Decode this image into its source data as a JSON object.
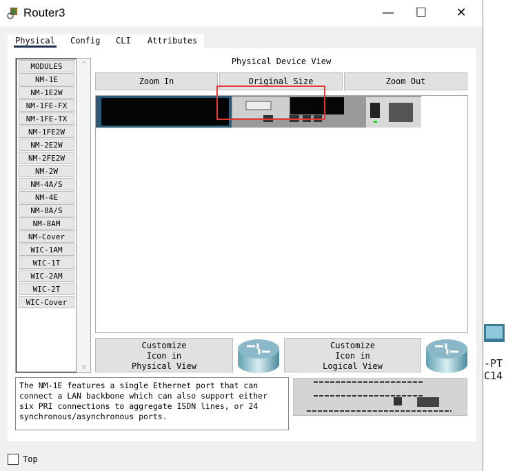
{
  "window": {
    "title": "Router3",
    "minimize": "—",
    "maximize": "☐",
    "close": "✕"
  },
  "tabs": [
    {
      "label": "Physical",
      "active": true
    },
    {
      "label": "Config"
    },
    {
      "label": "CLI"
    },
    {
      "label": "Attributes"
    }
  ],
  "modules": [
    "MODULES",
    "NM-1E",
    "NM-1E2W",
    "NM-1FE-FX",
    "NM-1FE-TX",
    "NM-1FE2W",
    "NM-2E2W",
    "NM-2FE2W",
    "NM-2W",
    "NM-4A/S",
    "NM-4E",
    "NM-8A/S",
    "NM-8AM",
    "NM-Cover",
    "WIC-1AM",
    "WIC-1T",
    "WIC-2AM",
    "WIC-2T",
    "WIC-Cover"
  ],
  "scroll": {
    "up": "^",
    "down": "v"
  },
  "physical_view": {
    "title": "Physical Device View",
    "zoom_in": "Zoom In",
    "original_size": "Original Size",
    "zoom_out": "Zoom Out",
    "highlight_color": "#e53935"
  },
  "customize": {
    "physical": [
      "Customize",
      "Icon in",
      "Physical View"
    ],
    "logical": [
      "Customize",
      "Icon in",
      "Logical View"
    ]
  },
  "description": "The NM-1E features a single Ethernet port that can\nconnect a LAN backbone which can also support either\nsix PRI connections to aggregate ISDN lines, or 24\nsynchronous/asynchronous ports.",
  "top_checkbox": {
    "label": "Top",
    "checked": false
  },
  "desktop": {
    "label1": "-PT",
    "label2": "C14"
  }
}
